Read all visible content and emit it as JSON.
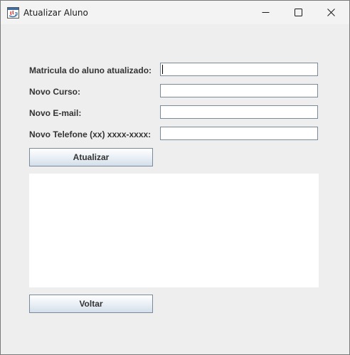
{
  "window": {
    "title": "Atualizar Aluno",
    "icon": "java-app-icon",
    "controls": {
      "minimize": "minimize-icon",
      "maximize": "maximize-icon",
      "close": "close-icon"
    }
  },
  "form": {
    "fields": [
      {
        "label": "Matricula do aluno atualizado:",
        "value": "",
        "focused": true
      },
      {
        "label": "Novo Curso:",
        "value": ""
      },
      {
        "label": "Novo E-mail:",
        "value": ""
      },
      {
        "label": "Novo Telefone (xx) xxxx-xxxx:",
        "value": ""
      }
    ],
    "update_button_label": "Atualizar",
    "output_text": "",
    "back_button_label": "Voltar"
  },
  "colors": {
    "window_background": "#eeeeee",
    "titlebar_background": "#f3f3f3",
    "label_text": "#333333",
    "input_border": "#7a8a99",
    "button_gradient_top": "#ffffff",
    "button_gradient_bottom": "#d4dfea"
  }
}
